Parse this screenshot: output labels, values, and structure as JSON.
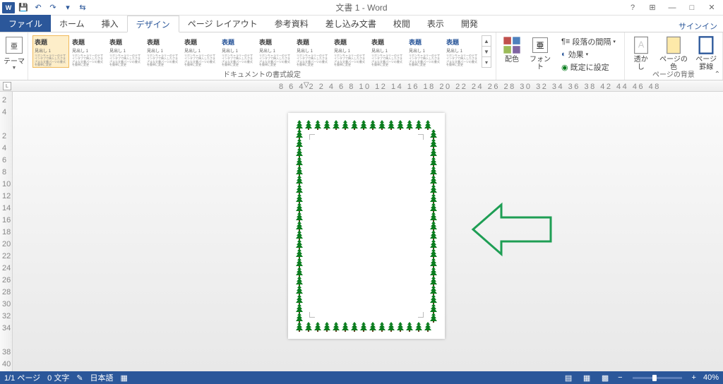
{
  "title": "文書 1 - Word",
  "qat": {
    "save": "💾",
    "undo": "↶",
    "redo": "↷",
    "dd": "▾",
    "sep": "⇆"
  },
  "winbtns": {
    "help": "?",
    "opts": "⊞",
    "min": "—",
    "max": "□",
    "close": "✕"
  },
  "tabs": {
    "file": "ファイル",
    "home": "ホーム",
    "insert": "挿入",
    "design": "デザイン",
    "layout": "ページ レイアウト",
    "ref": "参考資料",
    "mail": "差し込み文書",
    "review": "校閲",
    "view": "表示",
    "dev": "開発"
  },
  "signin": "サインイン",
  "ribbon": {
    "themes": {
      "label": "テーマ",
      "icon": "亜"
    },
    "gallery_label": "ドキュメントの書式設定",
    "gallery_items": [
      {
        "t": "表題",
        "c": "#444"
      },
      {
        "t": "表題",
        "c": "#444"
      },
      {
        "t": "表題",
        "c": "#444"
      },
      {
        "t": "表題",
        "c": "#444"
      },
      {
        "t": "表題",
        "c": "#444"
      },
      {
        "t": "表題",
        "c": "#2b579a"
      },
      {
        "t": "表題",
        "c": "#444"
      },
      {
        "t": "表題",
        "c": "#444"
      },
      {
        "t": "表題",
        "c": "#444"
      },
      {
        "t": "表題",
        "c": "#444"
      },
      {
        "t": "表題",
        "c": "#2b579a"
      },
      {
        "t": "表題",
        "c": "#2b579a"
      }
    ],
    "sub": "見出し 1",
    "colors": "配色",
    "fonts": "フォント",
    "spacing": "段落の間隔",
    "effects": "効果",
    "default": "既定に設定",
    "watermark": "透かし",
    "pagecolor": "ページの色",
    "borders": "ページ\n罫線",
    "bg_label": "ページの背景"
  },
  "ruler": {
    "left": "L",
    "nums": "8 6 4 2   2  4  6  8 10 12 14 16 18 20 22 24 26 28 30 32 34 36 38   42 44 46 48"
  },
  "vruler": [
    "2",
    "4",
    "",
    "2",
    "4",
    "6",
    "8",
    "10",
    "12",
    "14",
    "16",
    "18",
    "20",
    "22",
    "24",
    "26",
    "28",
    "30",
    "32",
    "34",
    "",
    "38",
    "40"
  ],
  "status": {
    "page": "1/1 ページ",
    "words": "0 文字",
    "lang": "日本語",
    "zoom": "40%"
  }
}
